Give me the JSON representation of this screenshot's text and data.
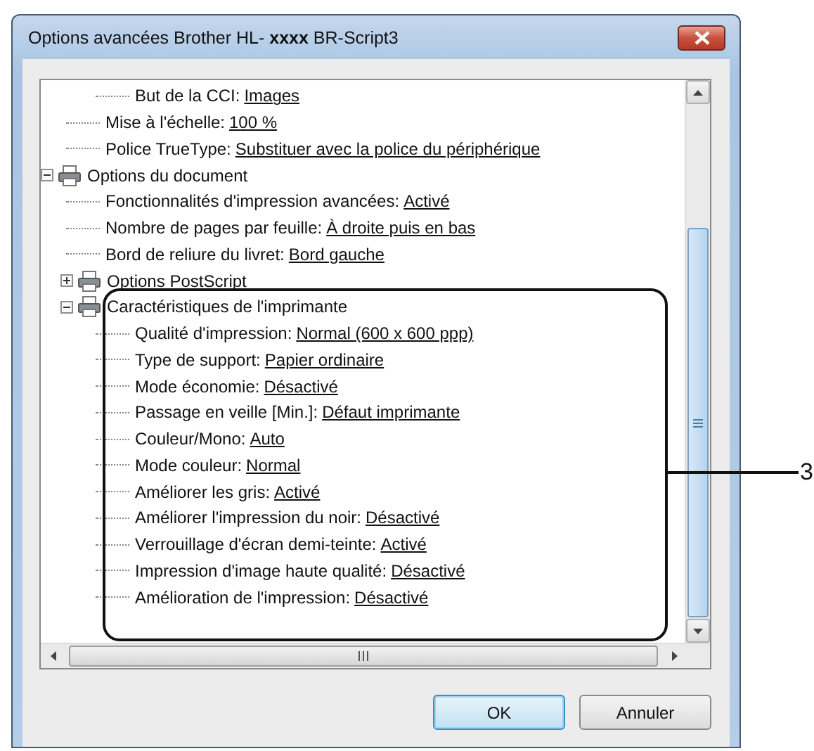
{
  "window": {
    "title": "Options avancées Brother HL- **xxxx** BR-Script3"
  },
  "tree": [
    {
      "children": [
        {
          "children": [
            {
              "label": "But de la CCI:",
              "value": "Images"
            }
          ]
        },
        {
          "label": "Mise à l'échelle:",
          "value": "100 %"
        },
        {
          "label": "Police TrueType:",
          "value": "Substituer avec la police du périphérique"
        }
      ]
    },
    {
      "label": "Options du document",
      "expanded": true,
      "children": [
        {
          "label": "Fonctionnalités d'impression avancées:",
          "value": "Activé"
        },
        {
          "label": "Nombre de pages par feuille:",
          "value": "À droite puis en bas"
        },
        {
          "label": "Bord de reliure du livret:",
          "value": "Bord gauche"
        },
        {
          "label": "Options PostScript",
          "expanded": false
        },
        {
          "label": "Caractéristiques de l'imprimante",
          "expanded": true,
          "children": [
            {
              "label": "Qualité d'impression:",
              "value": "Normal (600 x 600 ppp)"
            },
            {
              "label": "Type de support:",
              "value": "Papier ordinaire"
            },
            {
              "label": "Mode économie:",
              "value": "Désactivé"
            },
            {
              "label": "Passage en veille [Min.]:",
              "value": "Défaut imprimante"
            },
            {
              "label": "Couleur/Mono:",
              "value": "Auto"
            },
            {
              "label": "Mode couleur:",
              "value": "Normal"
            },
            {
              "label": "Améliorer les gris:",
              "value": "Activé"
            },
            {
              "label": "Améliorer l'impression du noir:",
              "value": "Désactivé"
            },
            {
              "label": "Verrouillage d'écran demi-teinte:",
              "value": "Activé"
            },
            {
              "label": "Impression d'image haute qualité:",
              "value": "Désactivé"
            },
            {
              "label": "Amélioration de l'impression:",
              "value": "Désactivé"
            }
          ]
        }
      ]
    }
  ],
  "buttons": [
    {
      "label": "OK",
      "default": true
    },
    {
      "label": "Annuler",
      "default": false
    }
  ],
  "callout": {
    "label": "3"
  }
}
